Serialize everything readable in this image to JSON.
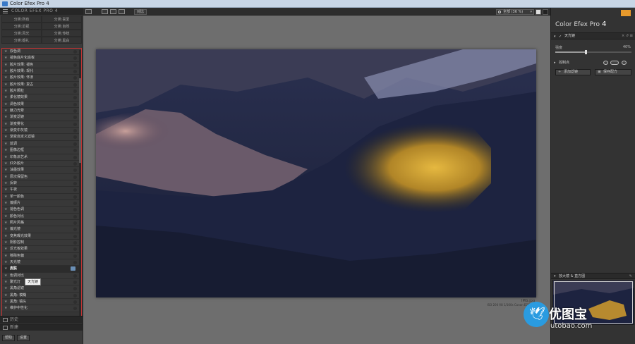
{
  "window": {
    "title": "Color Efex Pro 4"
  },
  "left_panel": {
    "header_label": "COLOR EFEX PRO 4",
    "categories": [
      [
        "分类:所有",
        "分类:喜爱"
      ],
      [
        "分类:近视",
        "分类:自然"
      ],
      [
        "分类:风光",
        "分类:传统"
      ],
      [
        "分类:婚礼",
        "分类:黑白"
      ]
    ],
    "filters": [
      "双色调",
      "褪色底片化底板",
      "胶片效果: 褪色",
      "胶片效果: 现代",
      "胶片效果: 怀旧",
      "胶片效果: 复古",
      "胶片颗粒",
      "柔化镜效果",
      "调色效果",
      "魅力光晕",
      "渐变滤镜",
      "渐变雾化",
      "渐变中灰镜",
      "渐变自定义滤镜",
      "蓝调",
      "图像边框",
      "印象派艺术",
      "红外胶片",
      "油墨效果",
      "层次保留色",
      "反转",
      "午夜",
      "单一颜色",
      "偏振片",
      "褪色色调",
      "颜色对比",
      "照片风格",
      "偏光镜",
      "变焦曝光效果",
      "阴影控制",
      "反光板效果",
      "移除色偏",
      "天光镜",
      "皮肤",
      "色调对比",
      "聚光灯",
      "黑角滤镜",
      "黑角: 模糊",
      "黑角: 镜头",
      "维护中性化"
    ],
    "active_filter_index": 33,
    "active_filter_label": "天光镜",
    "tooltip": "天光镜",
    "bottom_rows": [
      "历史",
      "新建"
    ],
    "bottom_buttons": [
      "帮助",
      "设置"
    ]
  },
  "toolbar": {
    "compare_label": "对比",
    "zoom_label": "全部 (36 %)"
  },
  "image_meta": {
    "filename": "IMG.jpg",
    "exif": "ISO 200  f/8  1/160s  Canon EOS 5D"
  },
  "right_panel": {
    "brand": "Color Efex Pro",
    "brand_version": "4",
    "section_title": "天光镜",
    "section_icons": "× ↺ ☰",
    "slider": {
      "label": "强度",
      "value": 40,
      "value_label": "40%"
    },
    "control_points_label": "控制点",
    "add_filter_label": "添加滤镜",
    "save_preset_label": "保存配方",
    "loupe_label": "放大镜 & 直方图",
    "accent": "#e89a2c"
  },
  "watermark": {
    "text": "优图宝",
    "url": "utobao.com",
    "color": "#2a9be0"
  }
}
